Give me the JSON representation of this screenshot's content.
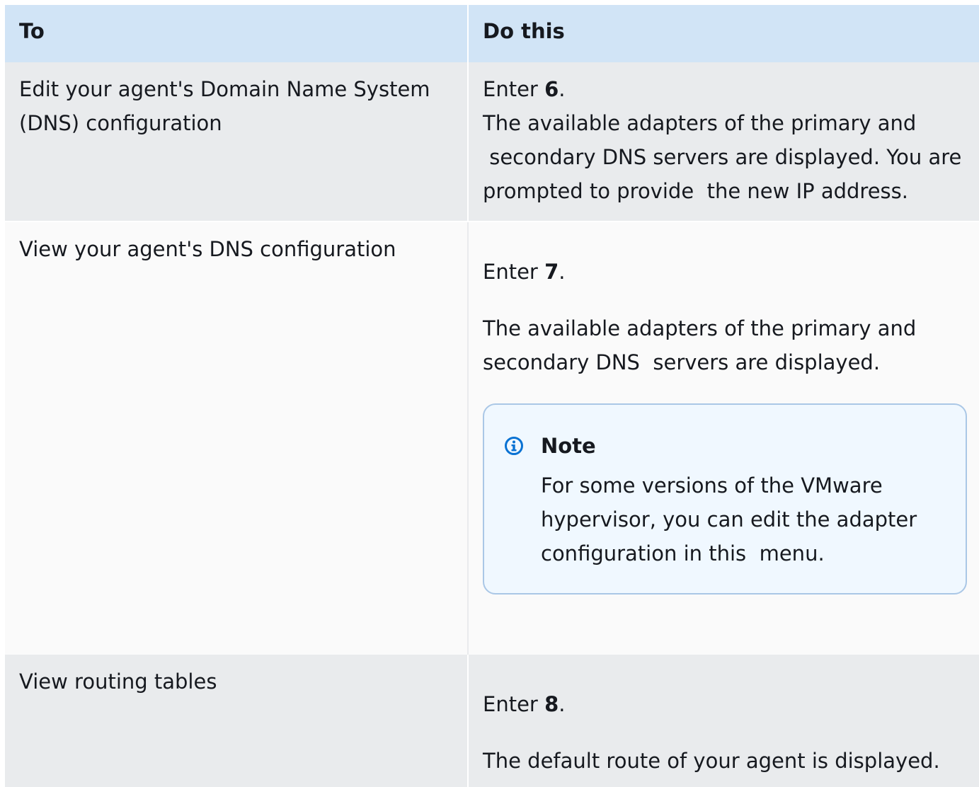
{
  "table": {
    "headers": [
      "To",
      "Do this"
    ],
    "rows": [
      {
        "to": "Edit your agent's Domain Name System (DNS) configuration",
        "do": {
          "enter_prefix": "Enter ",
          "enter_key": "6",
          "enter_suffix": ".",
          "desc_line1": "The available adapters of the primary and",
          "desc_line2": " secondary DNS servers are displayed. You are",
          "desc_line3": "prompted to provide  the new IP address."
        }
      },
      {
        "to": "View your agent's DNS configuration",
        "do": {
          "enter_prefix": "Enter ",
          "enter_key": "7",
          "enter_suffix": ".",
          "desc_line1": "The available adapters of the primary and",
          "desc_line2": "secondary DNS  servers are displayed.",
          "note": {
            "title": "Note",
            "icon": "info-icon",
            "line1": "For some versions of the VMware",
            "line2": "hypervisor, you can edit the adapter",
            "line3": "configuration in this  menu."
          }
        }
      },
      {
        "to": "View routing tables",
        "do": {
          "enter_prefix": "Enter ",
          "enter_key": "8",
          "enter_suffix": ".",
          "desc_line1": "The default route of your agent is displayed."
        }
      }
    ]
  },
  "colors": {
    "header_bg": "#d1e4f6",
    "row_gray": "#e9ebed",
    "row_white": "#fafafa",
    "note_border": "#aac7e6",
    "note_bg": "#f0f8ff",
    "info_icon": "#0972d3"
  }
}
